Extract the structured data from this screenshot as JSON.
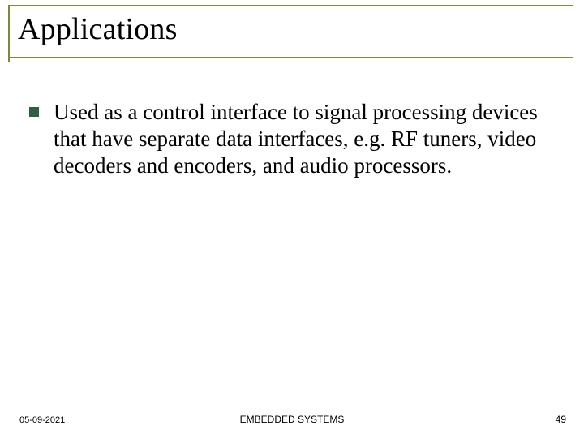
{
  "slide": {
    "title": "Applications",
    "bullets": [
      {
        "text": "Used as a control interface to signal processing devices that have separate data interfaces, e.g. RF tuners, video decoders and encoders, and audio processors."
      }
    ]
  },
  "footer": {
    "date": "05-09-2021",
    "center": "EMBEDDED SYSTEMS",
    "page": "49"
  },
  "colors": {
    "rule": "#7b8a3a",
    "bullet": "#2f5f3f"
  }
}
